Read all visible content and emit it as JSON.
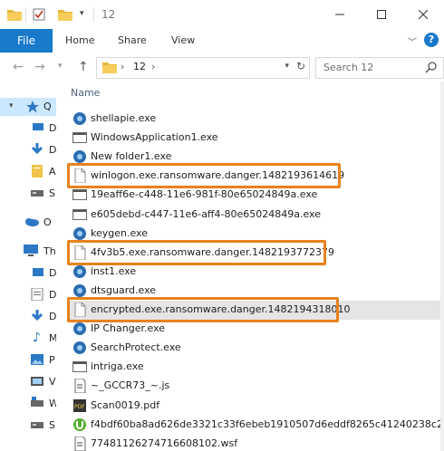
{
  "window": {
    "title": "12"
  },
  "ribbon": {
    "tabs": [
      "File",
      "Home",
      "Share",
      "View"
    ]
  },
  "address": {
    "path_segment": "12"
  },
  "search": {
    "placeholder": "Search 12"
  },
  "sidebar": {
    "items": [
      {
        "label": "Q",
        "icon": "star-icon"
      },
      {
        "label": "D",
        "icon": "desktop-icon"
      },
      {
        "label": "D",
        "icon": "download-icon"
      },
      {
        "label": "A",
        "icon": "documents-icon"
      },
      {
        "label": "S",
        "icon": "drive-icon"
      },
      {
        "label": "O",
        "icon": "cloud-icon"
      },
      {
        "label": "Th",
        "icon": "pc-icon"
      },
      {
        "label": "D",
        "icon": "folder-icon"
      },
      {
        "label": "D",
        "icon": "documents-icon"
      },
      {
        "label": "D",
        "icon": "download-icon"
      },
      {
        "label": "M",
        "icon": "music-icon"
      },
      {
        "label": "P",
        "icon": "pictures-icon"
      },
      {
        "label": "V",
        "icon": "videos-icon"
      },
      {
        "label": "W",
        "icon": "windows-drive-icon"
      },
      {
        "label": "S",
        "icon": "drive-icon"
      }
    ]
  },
  "list": {
    "column_name": "Name",
    "files": [
      {
        "name": "shellapie.exe",
        "icon": "app-icon"
      },
      {
        "name": "WindowsApplication1.exe",
        "icon": "exe-icon"
      },
      {
        "name": "New folder1.exe",
        "icon": "app-icon"
      },
      {
        "name": "winlogon.exe.ransomware.danger.1482193614619",
        "icon": "file-icon"
      },
      {
        "name": "19eaff6e-c448-11e6-981f-80e65024849a.exe",
        "icon": "exe-icon"
      },
      {
        "name": "e605debd-c447-11e6-aff4-80e65024849a.exe",
        "icon": "exe-icon"
      },
      {
        "name": "keygen.exe",
        "icon": "app-icon"
      },
      {
        "name": "4fv3b5.exe.ransomware.danger.1482193772379",
        "icon": "file-icon"
      },
      {
        "name": "inst1.exe",
        "icon": "app-icon"
      },
      {
        "name": "dtsguard.exe",
        "icon": "app-icon"
      },
      {
        "name": "encrypted.exe.ransomware.danger.1482194318010",
        "icon": "file-icon"
      },
      {
        "name": "IP Changer.exe",
        "icon": "app-icon"
      },
      {
        "name": "SearchProtect.exe",
        "icon": "app-icon"
      },
      {
        "name": "intriga.exe",
        "icon": "exe-icon"
      },
      {
        "name": "~_GCCR73_~.js",
        "icon": "script-icon"
      },
      {
        "name": "Scan0019.pdf",
        "icon": "pdf-icon"
      },
      {
        "name": "f4bdf60ba8ad626de3321c33f6ebeb1910507d6eddf8265c41240238c2d568",
        "icon": "torrent-icon"
      },
      {
        "name": "77481126274716608102.wsf",
        "icon": "script-icon"
      }
    ]
  }
}
